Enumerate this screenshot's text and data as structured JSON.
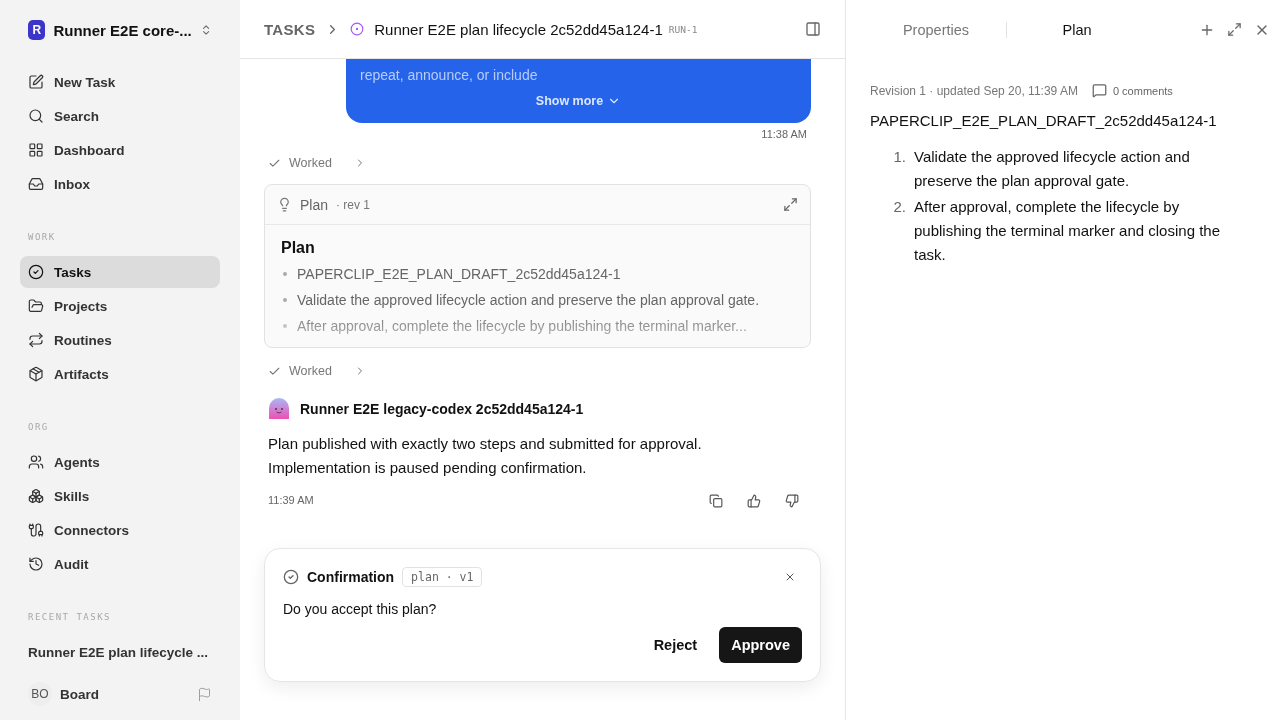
{
  "workspace": {
    "initial": "R",
    "name": "Runner E2E core-..."
  },
  "nav": [
    {
      "label": "New Task",
      "selected": false
    },
    {
      "label": "Search",
      "selected": false
    },
    {
      "label": "Dashboard",
      "selected": false
    },
    {
      "label": "Inbox",
      "selected": false
    }
  ],
  "sections": [
    {
      "title": "WORK",
      "items": [
        {
          "label": "Tasks",
          "selected": true
        },
        {
          "label": "Projects",
          "selected": false
        },
        {
          "label": "Routines",
          "selected": false
        },
        {
          "label": "Artifacts",
          "selected": false
        }
      ]
    },
    {
      "title": "ORG",
      "items": [
        {
          "label": "Agents",
          "selected": false
        },
        {
          "label": "Skills",
          "selected": false
        },
        {
          "label": "Connectors",
          "selected": false
        },
        {
          "label": "Audit",
          "selected": false
        }
      ]
    }
  ],
  "recent": {
    "title": "RECENT TASKS",
    "items": [
      "Runner E2E plan lifecycle ..."
    ]
  },
  "user": {
    "initials": "BO",
    "name": "Board"
  },
  "header": {
    "crumb": "TASKS",
    "title": "Runner E2E plan lifecycle 2c52dd45a124-1",
    "id": "RUN-1"
  },
  "bubble": {
    "text": "repeat, announce, or include",
    "show_more": "Show more",
    "time": "11:38 AM"
  },
  "worked": [
    "Worked",
    "Worked"
  ],
  "plan_card": {
    "title": "Plan",
    "rev": "· rev 1",
    "heading": "Plan",
    "items": [
      "PAPERCLIP_E2E_PLAN_DRAFT_2c52dd45a124-1",
      "Validate the approved lifecycle action and preserve the plan approval gate.",
      "After approval, complete the lifecycle by publishing the terminal marker..."
    ]
  },
  "message": {
    "author": "Runner E2E legacy-codex 2c52dd45a124-1",
    "lines": [
      "Plan published with exactly two steps and submitted for approval.",
      "Implementation is paused pending confirmation."
    ],
    "time": "11:39 AM"
  },
  "confirmation": {
    "title": "Confirmation",
    "tag": "plan · v1",
    "question": "Do you accept this plan?",
    "buttons": [
      {
        "label": "Reject",
        "kind": "secondary"
      },
      {
        "label": "Approve",
        "kind": "primary"
      }
    ]
  },
  "panel": {
    "tabs": [
      {
        "label": "Properties",
        "selected": false
      },
      {
        "label": "Plan",
        "selected": true
      }
    ],
    "meta": "Revision 1 · updated Sep 20, 11:39 AM",
    "comments": "0 comments",
    "doc_title": "PAPERCLIP_E2E_PLAN_DRAFT_2c52dd45a124-1",
    "steps": [
      {
        "num": "1.",
        "text": "Validate the approved lifecycle action and preserve the plan approval gate."
      },
      {
        "num": "2.",
        "text": "After approval, complete the lifecycle by publishing the terminal marker and closing the task."
      }
    ]
  }
}
